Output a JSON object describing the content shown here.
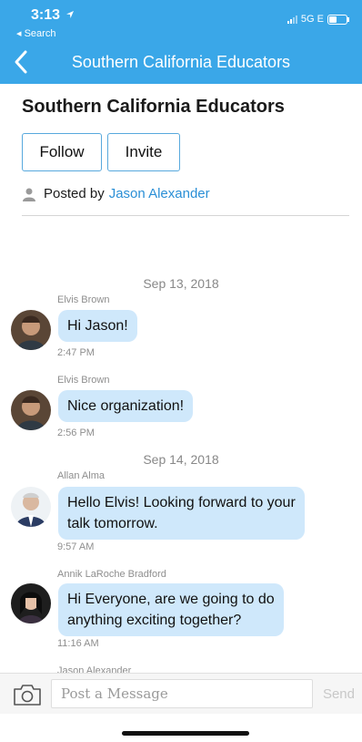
{
  "status_bar": {
    "time": "3:13",
    "back_label": "◂ Search",
    "network": "5G E"
  },
  "nav": {
    "title": "Southern California Educators"
  },
  "group": {
    "title": "Southern California Educators",
    "follow_label": "Follow",
    "invite_label": "Invite",
    "posted_by_label": "Posted by",
    "posted_by_name": "Jason Alexander"
  },
  "dates": [
    "Sep 13, 2018",
    "Sep 14, 2018"
  ],
  "messages": [
    {
      "sender": "Elvis Brown",
      "lines": [
        "Hi Jason!"
      ],
      "time": "2:47 PM"
    },
    {
      "sender": "Elvis Brown",
      "lines": [
        "Nice organization!"
      ],
      "time": "2:56 PM"
    },
    {
      "sender": "Allan Alma",
      "lines": [
        "Hello Elvis! Looking forward to your",
        "talk tomorrow."
      ],
      "time": "9:57 AM"
    },
    {
      "sender": "Annik LaRoche Bradford",
      "lines": [
        "Hi Everyone, are we going to do",
        "anything exciting together?"
      ],
      "time": "11:16 AM"
    },
    {
      "sender": "Jason Alexander"
    }
  ],
  "composer": {
    "placeholder": "Post a Message",
    "send_label": "Send"
  },
  "colors": {
    "header": "#3aa7e8",
    "bubble": "#cfe8fb",
    "link": "#2a8fd6",
    "button_border": "#58a9dd"
  },
  "icons": [
    "location-arrow-icon",
    "signal-icon",
    "battery-icon",
    "back-chevron-icon",
    "person-icon",
    "camera-icon"
  ]
}
